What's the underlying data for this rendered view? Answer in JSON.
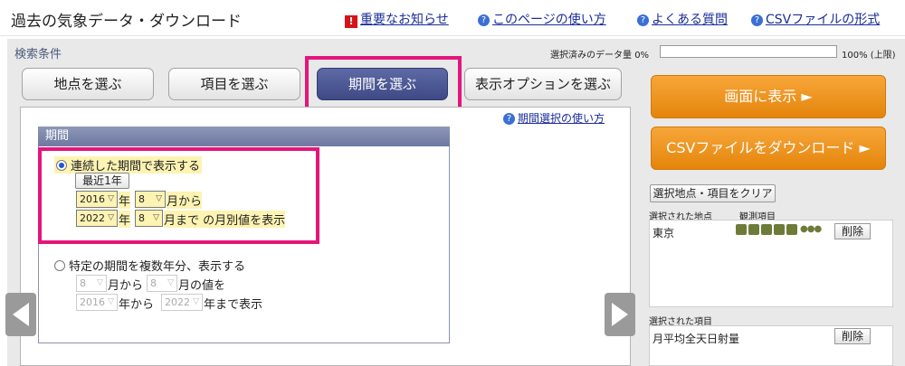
{
  "header": {
    "title": "過去の気象データ・ダウンロード",
    "links": {
      "notice": "重要なお知らせ",
      "howto": "このページの使い方",
      "faq": "よくある質問",
      "csv_format": "CSVファイルの形式"
    }
  },
  "conditions": {
    "label": "検索条件",
    "data_amount_label": "選択済みのデータ量",
    "data_amount_value": "0%",
    "data_amount_fraction": 0,
    "data_amount_max": "100% (上限)"
  },
  "tabs": [
    {
      "label": "地点を選ぶ",
      "active": false
    },
    {
      "label": "項目を選ぶ",
      "active": false
    },
    {
      "label": "期間を選ぶ",
      "active": true
    },
    {
      "label": "表示オプションを選ぶ",
      "active": false
    }
  ],
  "period": {
    "help_link": "期間選択の使い方",
    "header": "期間",
    "option1": {
      "label": "連続した期間で表示する",
      "recent_button": "最近1年",
      "from_year": "2016",
      "from_month": "8",
      "year_unit": "年",
      "from_suffix": "月から",
      "to_year": "2022",
      "to_month": "8",
      "to_suffix": "月まで の月別値を表示"
    },
    "option2": {
      "label": "特定の期間を複数年分、表示する",
      "month_from": "8",
      "month_from_suffix": "月から",
      "month_to": "8",
      "month_to_suffix": "月の値を",
      "year_from": "2016",
      "year_from_suffix": "年から",
      "year_to": "2022",
      "year_to_suffix": "年まで表示"
    }
  },
  "right": {
    "show_button": "画面に表示 ►",
    "download_button": "CSVファイルをダウンロード ►",
    "clear_button": "選択地点・項目をクリア",
    "selected_stations_label": "選択された地点",
    "observation_items_label": "観測項目",
    "station_name": "東京",
    "delete_label": "削除",
    "selected_items_label": "選択された項目",
    "item_name": "月平均全天日射量"
  },
  "colors": {
    "accent_pink": "#e5157c",
    "active_tab": "#4a5590",
    "orange_button": "#f0961f"
  }
}
